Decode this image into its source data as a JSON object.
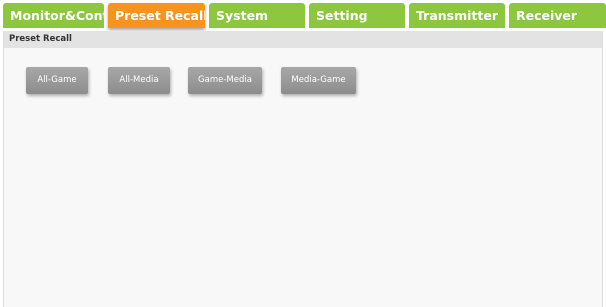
{
  "tabs": [
    {
      "label": "Monitor&Control"
    },
    {
      "label": "Preset Recall"
    },
    {
      "label": "System"
    },
    {
      "label": "Setting"
    },
    {
      "label": "Transmitter"
    },
    {
      "label": "Receiver"
    }
  ],
  "active_tab_index": 1,
  "panel": {
    "title": "Preset Recall"
  },
  "presets": [
    {
      "label": "All-Game"
    },
    {
      "label": "All-Media"
    },
    {
      "label": "Game-Media"
    },
    {
      "label": "Media-Game"
    }
  ],
  "colors": {
    "tab_default": "#8dc63f",
    "tab_active": "#f7941d",
    "preset_button": "#9a9a9a",
    "panel_background": "#f8f8f8",
    "panel_header": "#e3e3e3"
  }
}
